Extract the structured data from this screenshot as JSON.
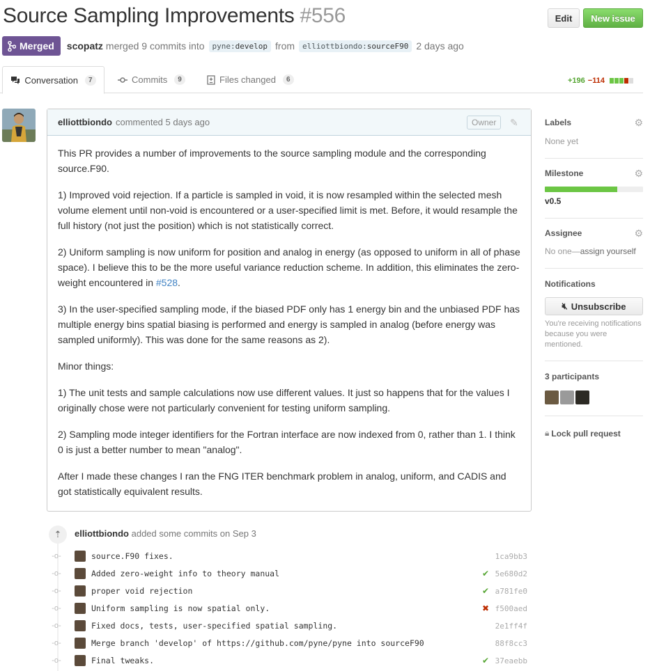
{
  "header": {
    "title": "Source Sampling Improvements",
    "number": "#556",
    "edit_label": "Edit",
    "new_issue_label": "New issue"
  },
  "meta": {
    "state_label": "Merged",
    "author": "scopatz",
    "merged_text": "merged 9 commits into",
    "base_repo": "pyne",
    "base_branch": "develop",
    "from_text": "from",
    "head_repo": "elliottbiondo",
    "head_branch": "sourceF90",
    "when": "2 days ago"
  },
  "tabs": [
    {
      "label": "Conversation",
      "count": "7"
    },
    {
      "label": "Commits",
      "count": "9"
    },
    {
      "label": "Files changed",
      "count": "6"
    }
  ],
  "diffstat": {
    "additions": "+196",
    "deletions": "−114",
    "blocks": [
      "#6cc644",
      "#6cc644",
      "#6cc644",
      "#bd2c00",
      "#ddd"
    ]
  },
  "comment": {
    "author": "elliottbiondo",
    "when": "commented 5 days ago",
    "role": "Owner",
    "paragraphs": [
      "This PR provides a number of improvements to the source sampling module and the corresponding source.F90.",
      "1) Improved void rejection. If a particle is sampled in void, it is now resampled within the selected mesh volume element until non-void is encountered or a user-specified limit is met. Before, it would resample the full history (not just the position) which is not statistically correct.",
      "2) Uniform sampling is now uniform for position and analog in energy (as opposed to uniform in all of phase space). I believe this to be the more useful variance reduction scheme. In addition, this eliminates the zero-weight encountered in ",
      "3) In the user-specified sampling mode, if the biased PDF only has 1 energy bin and the unbiased PDF has multiple energy bins spatial biasing is performed and energy is sampled in analog (before energy was sampled uniformly). This was done for the same reasons as 2).",
      "Minor things:",
      "1) The unit tests and sample calculations now use different values. It just so happens that for the values I originally chose were not particularly convenient for testing uniform sampling.",
      "2) Sampling mode integer identifiers for the Fortran interface are now indexed from 0, rather than 1. I think 0 is just a better number to mean \"analog\".",
      "After I made these changes I ran the FNG ITER benchmark problem in analog, uniform, and CADIS and got statistically equivalent results."
    ],
    "issue_link": "#528",
    "issue_link_suffix": "."
  },
  "sidebar": {
    "labels_title": "Labels",
    "labels_value": "None yet",
    "milestone_title": "Milestone",
    "milestone_progress": 0.74,
    "milestone_value": "v0.5",
    "assignee_title": "Assignee",
    "assignee_value": "No one—",
    "assignee_link": "assign yourself",
    "notifications_title": "Notifications",
    "unsubscribe_label": "Unsubscribe",
    "notifications_reason": "You're receiving notifications because you were mentioned.",
    "participants_title": "3 participants",
    "lock_label": "Lock pull request"
  },
  "commits": {
    "author": "elliottbiondo",
    "header_text": "added some commits on Sep 3",
    "items": [
      {
        "message": "source.F90 fixes.",
        "sha": "1ca9bb3",
        "status": ""
      },
      {
        "message": "Added zero-weight info to theory manual",
        "sha": "5e680d2",
        "status": "ok"
      },
      {
        "message": "proper void rejection",
        "sha": "a781fe0",
        "status": "ok"
      },
      {
        "message": "Uniform sampling is now spatial only.",
        "sha": "f500aed",
        "status": "fail"
      },
      {
        "message": "Fixed docs, tests, user-specified spatial sampling.",
        "sha": "2e1ff4f",
        "status": ""
      },
      {
        "message": "Merge branch 'develop' of https://github.com/pyne/pyne into sourceF90",
        "sha": "88f8cc3",
        "status": ""
      },
      {
        "message": "Final tweaks.",
        "sha": "37eaebb",
        "status": "ok"
      }
    ]
  }
}
